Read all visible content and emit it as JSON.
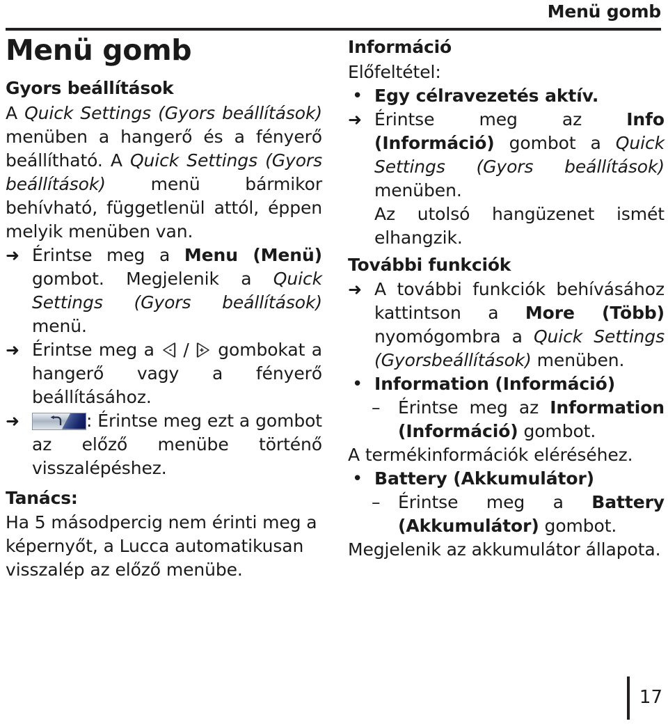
{
  "header": {
    "running_title": "Menü gomb"
  },
  "left": {
    "doc_title": "Menü gomb",
    "section1_heading": "Gyors beállítások",
    "para1": {
      "a": "A ",
      "b_italic": "Quick Settings (Gyors beállítások)",
      "c": " menüben a hangerő és a fényerő beállítható. A ",
      "d_italic": "Quick Settings (Gyors beállítások)",
      "e": " menü bármikor behívható, függetlenül attól, éppen melyik menüben van."
    },
    "step1": {
      "marker": "arrow-right-icon",
      "a": "Érintse meg a ",
      "b_bold": "Menu (Menü)",
      "c": " gombot. Megjelenik a ",
      "d_italic": "Quick Settings (Gyors beállítások)",
      "e": " menü."
    },
    "step2": {
      "marker": "arrow-right-icon",
      "a": "Érintse meg a ",
      "icon_left": "volume-down-button-icon",
      "separator": " / ",
      "icon_right": "volume-up-button-icon",
      "b": " gombokat a hangerő vagy a fényerő beállításához."
    },
    "step3": {
      "marker": "arrow-right-icon",
      "icon": "back-button-icon",
      "a": ": Érintse meg ezt a gombot az előző menübe történő visszalépéshez."
    },
    "tip_heading": "Tanács:",
    "tip_text": "Ha 5 másodpercig nem érinti meg a képernyőt, a Lucca automatikusan visszalép az előző menübe."
  },
  "right": {
    "section1_heading": "Információ",
    "precondition_label": "Előfeltétel:",
    "precondition_item": {
      "marker": "bullet-icon",
      "text_bold": "Egy célravezetés aktív."
    },
    "step1": {
      "marker": "arrow-right-icon",
      "a": "Érintse meg az ",
      "b_bold": "Info (Információ)",
      "c": " gombot a ",
      "d_italic": "Quick Settings (Gyors beállítások)",
      "e": " menüben."
    },
    "step1_follow": "Az utolsó hangüzenet ismét elhangzik.",
    "section2_heading": "További funkciók",
    "step2": {
      "marker": "arrow-right-icon",
      "a": "A további funkciók behívásához kattintson a ",
      "b_bold": "More (Több)",
      "c": " nyomógombra a ",
      "d_italic": "Quick Settings (Gyorsbeállítások)",
      "e": " menüben."
    },
    "item_information": {
      "marker": "bullet-icon",
      "label_bold": "Information (Információ)"
    },
    "item_information_sub": {
      "marker": "dash-icon",
      "a": "Érintse meg az ",
      "b_bold": "Information (Információ)",
      "c": " gombot."
    },
    "item_information_follow": "A termékinformációk eléréséhez.",
    "item_battery": {
      "marker": "bullet-icon",
      "label_bold": "Battery (Akkumulátor)"
    },
    "item_battery_sub": {
      "marker": "dash-icon",
      "a": "Érintse meg a ",
      "b_bold": "Battery (Akkumulátor)",
      "c": " gombot."
    },
    "item_battery_follow": "Megjelenik az akkumulátor állapota."
  },
  "footer": {
    "page_number": "17"
  },
  "markers": {
    "arrow": "➜",
    "bullet": "•",
    "dash": "–",
    "slash": "/",
    "colon": ":"
  },
  "colors": {
    "text": "#1a1a1a",
    "rule": "#231f20",
    "icon_back_blue": "#16246b",
    "icon_back_silver": "#cfd7e0"
  }
}
